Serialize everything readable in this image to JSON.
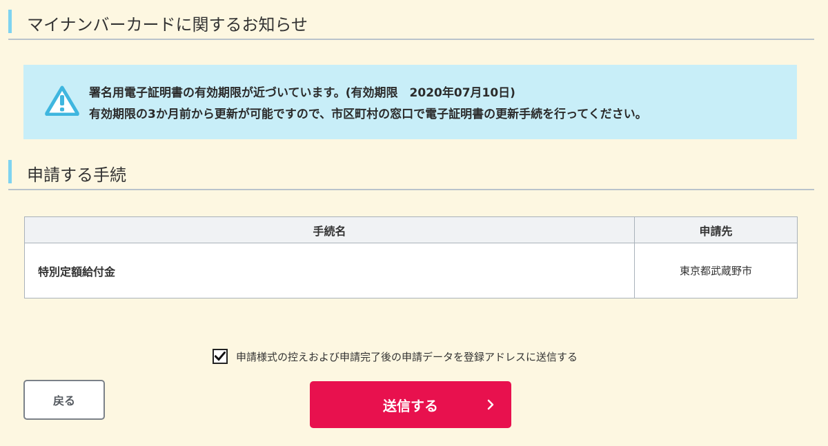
{
  "sections": {
    "notice_heading": "マイナンバーカードに関するお知らせ",
    "procedure_heading": "申請する手続"
  },
  "notice": {
    "line1": "署名用電子証明書の有効期限が近づいています。(有効期限　2020年07月10日)",
    "line2": "有効期限の3か月前から更新が可能ですので、市区町村の窓口で電子証明書の更新手続を行ってください。",
    "icon": "warning-icon"
  },
  "procedure_table": {
    "headers": [
      "手続名",
      "申請先"
    ],
    "rows": [
      {
        "name": "特別定額給付金",
        "destination": "東京都武蔵野市"
      }
    ]
  },
  "consent": {
    "label": "申請様式の控えおよび申請完了後の申請データを登録アドレスに送信する",
    "checked": true
  },
  "buttons": {
    "back_label": "戻る",
    "submit_label": "送信する"
  },
  "colors": {
    "page_background": "#fdf7e1",
    "accent_bar": "#7fd3f0",
    "notice_background": "#c8eef8",
    "submit_button": "#e8114e"
  }
}
